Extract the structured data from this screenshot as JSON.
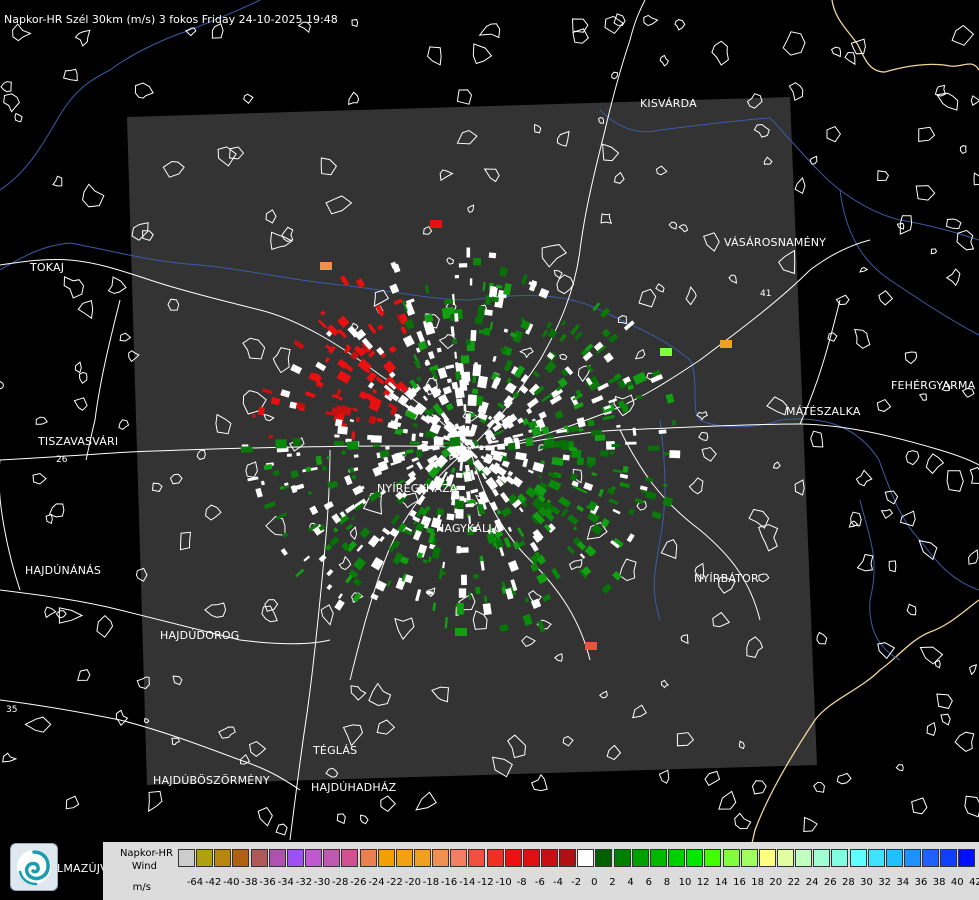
{
  "map": {
    "title": "Napkor-HR Szél 30km (m/s) 3 fokos Friday 24-10-2025 19:48",
    "cities": [
      {
        "id": "kisvarda",
        "label": "KISVÁRDA"
      },
      {
        "id": "vasarosnameny",
        "label": "VÁSÁROSNAMÉNY"
      },
      {
        "id": "tokaj",
        "label": "TOKAJ"
      },
      {
        "id": "fehergyarmat",
        "label": "FEHÉRGYARMA"
      },
      {
        "id": "mateszalka",
        "label": "MÁTÉSZALKA"
      },
      {
        "id": "tiszavasvari",
        "label": "TISZAVASVÁRI"
      },
      {
        "id": "nyiregyhaza",
        "label": "NYÍREGYHÁZA"
      },
      {
        "id": "nagykallo",
        "label": "NAGYKÁLLÓ"
      },
      {
        "id": "nyirbator",
        "label": "NYÍRBÁTOR"
      },
      {
        "id": "hajdunanas",
        "label": "HAJDÚNÁNÁS"
      },
      {
        "id": "hajdudorog",
        "label": "HAJDÚDOROG"
      },
      {
        "id": "teglas",
        "label": "TÉGLÁS"
      },
      {
        "id": "hajduboszormeny",
        "label": "HAJDÚBÖSZÖRMÉNY"
      },
      {
        "id": "hajduhadhaz",
        "label": "HAJDÚHADHÁZ"
      },
      {
        "id": "balmazujvaros",
        "label": "LMAZÚJVÁR"
      }
    ],
    "road_numbers": [
      "26",
      "35",
      "41"
    ],
    "colors": {
      "background": "#000000",
      "radar_footprint": "#333333",
      "road": "#ffffff",
      "river": "#3b5ca8",
      "border": "#f2d49b",
      "approaching": "#e81010",
      "receding": "#0a8a0a",
      "near_zero": "#ffffff"
    }
  },
  "legend": {
    "label_line1": "Napkor-HR",
    "label_line2": "Wind",
    "label_line3": "m/s",
    "ticks": [
      "-64",
      "-42",
      "-40",
      "-38",
      "-36",
      "-34",
      "-32",
      "-30",
      "-28",
      "-26",
      "-24",
      "-22",
      "-20",
      "-18",
      "-16",
      "-14",
      "-12",
      "-10",
      "-8",
      "-6",
      "-4",
      "-2",
      "0",
      "2",
      "4",
      "6",
      "8",
      "10",
      "12",
      "14",
      "16",
      "18",
      "20",
      "22",
      "24",
      "26",
      "28",
      "30",
      "32",
      "34",
      "36",
      "38",
      "40",
      "42"
    ],
    "swatch_colors": [
      "#cccccc",
      "#b0a010",
      "#b88510",
      "#b06010",
      "#b05858",
      "#b050b0",
      "#a050f0",
      "#c058d0",
      "#c058b0",
      "#d05090",
      "#e88050",
      "#f0a000",
      "#f0a010",
      "#f0a020",
      "#f09050",
      "#f08060",
      "#f05040",
      "#f03020",
      "#f01010",
      "#e01010",
      "#c81010",
      "#b01010",
      "#ffffff",
      "#006000",
      "#008000",
      "#00a000",
      "#00b800",
      "#00d000",
      "#00e800",
      "#40ff00",
      "#80ff40",
      "#a0ff60",
      "#ffff80",
      "#e0ffa0",
      "#c0ffc0",
      "#a0ffd0",
      "#80ffe0",
      "#60ffff",
      "#40e0ff",
      "#20c0ff",
      "#2090ff",
      "#2060ff",
      "#1040ff",
      "#0010ff"
    ]
  }
}
